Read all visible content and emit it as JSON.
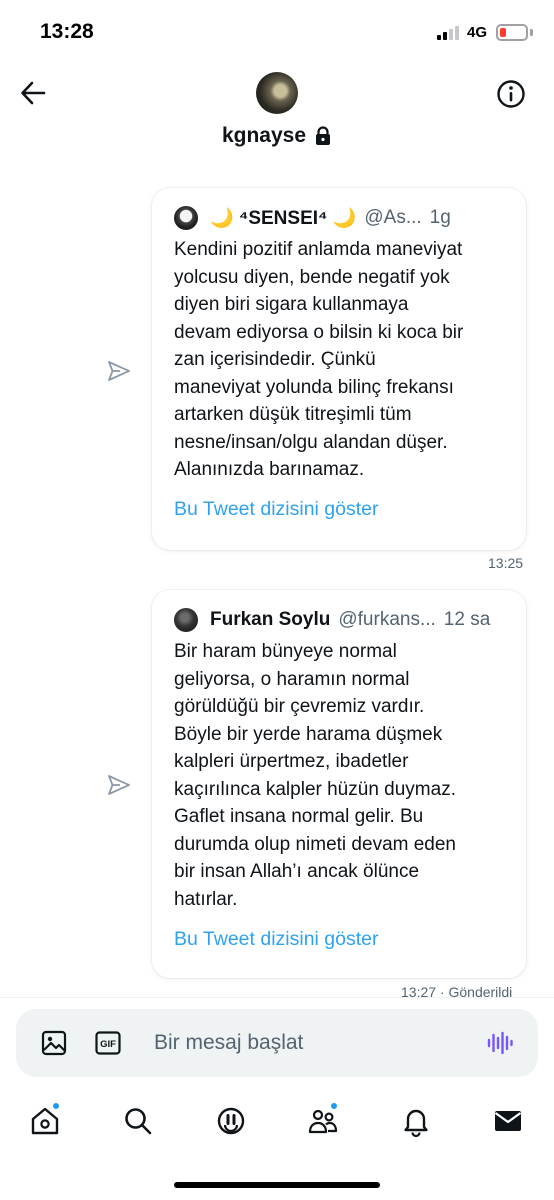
{
  "status_bar": {
    "time": "13:28",
    "network": "4G"
  },
  "header": {
    "username": "kgnayse",
    "locked_icon": "lock-icon",
    "back_icon": "arrow-left-icon",
    "info_icon": "info-circle-icon"
  },
  "messages": [
    {
      "tweet": {
        "author_name": "🌙 ⁴SENSEI⁴ 🌙",
        "handle": "@As...",
        "age": "1g",
        "text": "Kendini pozitif anlamda maneviyat\nyolcusu diyen, bende negatif yok\ndiyen biri sigara kullanmaya\ndevam ediyorsa o bilsin ki koca bir\nzan içerisindedir. Çünkü\nmaneviyat yolunda bilinç frekansı\nartarken düşük titreşimli tüm\nnesne/insan/olgu alandan düşer.\nAlanınızda barınamaz.",
        "thread_link": "Bu Tweet dizisini göster"
      },
      "meta": "13:25"
    },
    {
      "tweet": {
        "author_name": "Furkan Soylu",
        "handle": "@furkans...",
        "age": "12 sa",
        "text": "Bir haram bünyeye normal\ngeliyorsa, o haramın normal\ngörüldüğü bir çevremiz vardır.\nBöyle bir yerde harama düşmek\nkalpleri ürpertmez, ibadetler\nkaçırılınca kalpler hüzün duymaz.\nGaflet insana normal gelir. Bu\ndurumda olup nimeti devam eden\nbir insan Allah’ı ancak ölünce\nhatırlar.",
        "thread_link": "Bu Tweet dizisini göster"
      },
      "meta": "13:27 · Gönderildi"
    }
  ],
  "composer": {
    "placeholder": "Bir mesaj başlat",
    "gif_label": "GIF"
  },
  "tab_bar": {
    "items": [
      {
        "icon": "home-icon",
        "has_dot": true
      },
      {
        "icon": "search-icon",
        "has_dot": false
      },
      {
        "icon": "spaces-icon",
        "has_dot": false
      },
      {
        "icon": "communities-icon",
        "has_dot": true
      },
      {
        "icon": "bell-icon",
        "has_dot": false
      },
      {
        "icon": "mail-icon",
        "has_dot": false
      }
    ]
  },
  "colors": {
    "accent": "#1d9bf0",
    "text": "#0f1419",
    "secondary": "#536471",
    "composer_bg": "#eff3f4",
    "battery_low": "#ff3b30"
  }
}
